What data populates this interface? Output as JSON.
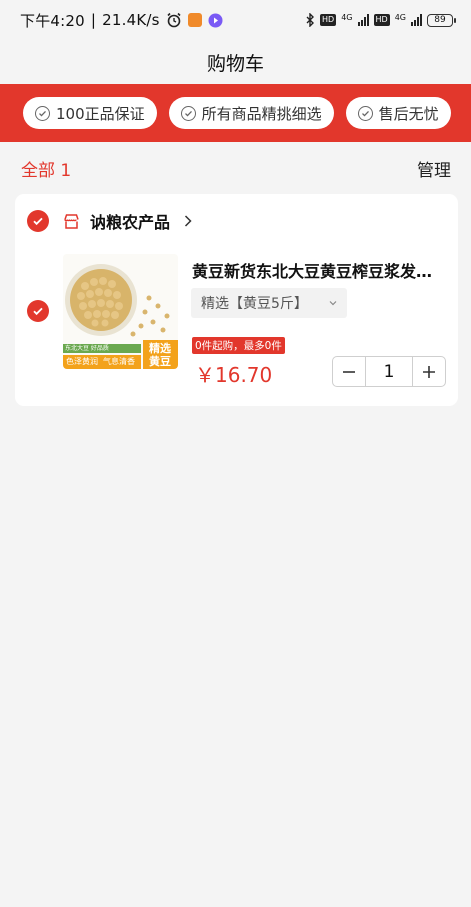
{
  "status_bar": {
    "time": "下午4:20",
    "separator": "|",
    "net_speed": "21.4K/s",
    "icons": [
      "alarm-icon",
      "app-notification-icon",
      "video-app-icon",
      "bluetooth-icon",
      "hd-icon",
      "signal-icon",
      "hd-icon",
      "signal-icon",
      "battery-icon"
    ],
    "network_label_1": "4G",
    "network_label_2": "4G",
    "battery": "89"
  },
  "header": {
    "title": "购物车"
  },
  "guarantees": [
    {
      "label": "100正品保证"
    },
    {
      "label": "所有商品精挑细选"
    },
    {
      "label": "售后无忧"
    }
  ],
  "summary": {
    "all_label": "全部 1",
    "manage_label": "管理"
  },
  "cart": {
    "shop": {
      "name": "讷粮农产品",
      "icon": "store-icon"
    },
    "items": [
      {
        "title": "黄豆新货东北大豆黄豆榨豆浆发…",
        "spec": "精选【黄豆5斤】",
        "limit": "0件起购，最多0件",
        "price": "￥16.70",
        "quantity": "1",
        "image_text": {
          "top_small": "东北大豆 好品质",
          "banner_left_1": "色泽黄润",
          "banner_left_2": "气息清香",
          "tag_1": "精选",
          "tag_2": "黄豆"
        }
      }
    ]
  },
  "colors": {
    "accent": "#e2372c",
    "background": "#f4f4f4"
  }
}
